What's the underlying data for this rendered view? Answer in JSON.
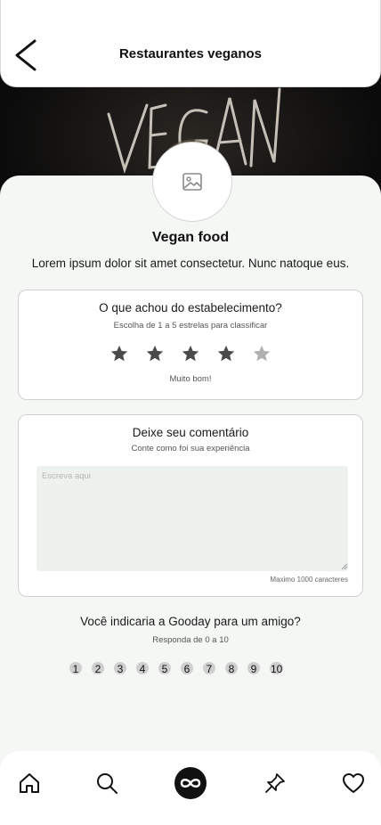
{
  "header": {
    "title": "Restaurantes veganos",
    "back_icon": "chevron-left-icon"
  },
  "hero": {
    "image_text": "VEGAN"
  },
  "place": {
    "avatar_icon": "image-placeholder-icon",
    "name": "Vegan food",
    "description": "Lorem ipsum dolor sit amet consectetur. Nunc natoque eus."
  },
  "rating": {
    "title": "O que achou do estabelecimento?",
    "subtitle": "Escolha de 1 a 5 estrelas para classificar",
    "value": 4,
    "max": 5,
    "label": "Muito bom!",
    "star_filled_color": "#4a4a4a",
    "star_empty_color": "#b0b0b0"
  },
  "comment": {
    "title": "Deixe seu comentário",
    "subtitle": "Conte como foi sua experiência",
    "placeholder": "Escreva aqui",
    "value": "",
    "limit_text": "Maximo 1000 caracteres"
  },
  "recommend": {
    "question": "Você indicaria a Gooday para um amigo?",
    "subtitle": "Responda de 0 a 10",
    "options": [
      "1",
      "2",
      "3",
      "4",
      "5",
      "6",
      "7",
      "8",
      "9",
      "10"
    ]
  },
  "bottom_nav": {
    "items": [
      "home-icon",
      "search-icon",
      "infinity-icon",
      "pin-icon",
      "heart-icon"
    ],
    "active": "infinity-icon"
  }
}
